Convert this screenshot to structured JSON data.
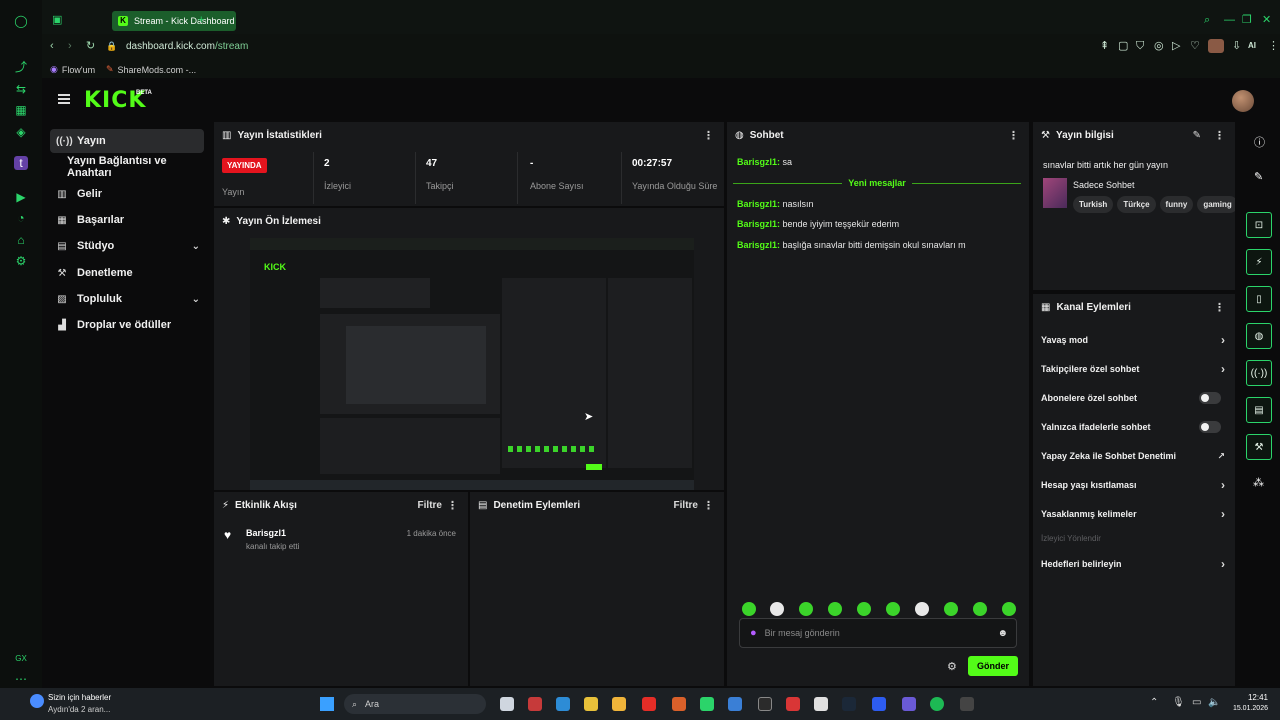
{
  "browser": {
    "tab_title": "Stream - Kick Dashboard",
    "url_host": "dashboard.kick.com",
    "url_path": "/stream",
    "bookmarks": [
      "Flow'um",
      "ShareMods.com -..."
    ],
    "ai_label": "AI"
  },
  "header": {
    "logo": "KICK",
    "beta": "BETA"
  },
  "sidebar": {
    "items": [
      {
        "label": "Yayın",
        "icon": "broadcast-icon"
      },
      {
        "label": "Yayın Bağlantısı ve Anahtarı"
      },
      {
        "label": "Gelir",
        "icon": "chart-icon"
      },
      {
        "label": "Başarılar",
        "icon": "trophy-icon"
      },
      {
        "label": "Stüdyo",
        "icon": "studio-icon"
      },
      {
        "label": "Denetleme",
        "icon": "wrench-icon"
      },
      {
        "label": "Topluluk",
        "icon": "community-icon"
      },
      {
        "label": "Droplar ve ödüller",
        "icon": "drops-icon"
      }
    ]
  },
  "stats": {
    "title": "Yayın İstatistikleri",
    "status_badge": "YAYINDA",
    "status_label": "Yayın",
    "viewers_value": "2",
    "viewers_label": "İzleyici",
    "followers_value": "47",
    "followers_label": "Takipçi",
    "subs_value": "-",
    "subs_label": "Abone Sayısı",
    "duration_value": "00:27:57",
    "duration_label": "Yayında Olduğu Süre"
  },
  "preview": {
    "title": "Yayın Ön İzlemesi"
  },
  "activity": {
    "title": "Etkinlik Akışı",
    "filter": "Filtre",
    "items": [
      {
        "user": "Barisgzl1",
        "action": "kanalı takip etti",
        "time": "1 dakika önce"
      }
    ]
  },
  "moderation_actions": {
    "title": "Denetim Eylemleri",
    "filter": "Filtre"
  },
  "chat": {
    "title": "Sohbet",
    "messages_before": [
      {
        "user": "Barisgzl1:",
        "text": "sa"
      }
    ],
    "new_messages_label": "Yeni mesajlar",
    "messages_after": [
      {
        "user": "Barisgzl1:",
        "text": "nasılsın"
      },
      {
        "user": "Barisgzl1:",
        "text": "bende iyiyim teşşekür ederim"
      },
      {
        "user": "Barisgzl1:",
        "text": "başlığa sınavlar bitti demişsin okul sınavları m"
      }
    ],
    "input_placeholder": "Bir mesaj gönderin",
    "send_label": "Gönder"
  },
  "stream_info": {
    "title": "Yayın bilgisi",
    "stream_title": "sınavlar bitti artık her gün yayın",
    "category": "Sadece Sohbet",
    "tags": [
      "Turkish",
      "Türkçe",
      "funny",
      "gaming"
    ]
  },
  "channel_actions": {
    "title": "Kanal Eylemleri",
    "items": [
      {
        "label": "Yavaş mod",
        "control": "chevron"
      },
      {
        "label": "Takipçilere özel sohbet",
        "control": "chevron"
      },
      {
        "label": "Abonelere özel sohbet",
        "control": "toggle"
      },
      {
        "label": "Yalnızca ifadelerle sohbet",
        "control": "toggle"
      },
      {
        "label": "Yapay Zeka ile Sohbet Denetimi",
        "control": "external"
      },
      {
        "label": "Hesap yaşı kısıtlaması",
        "control": "chevron"
      },
      {
        "label": "Yasaklanmış kelimeler",
        "control": "chevron"
      }
    ],
    "section_label": "İzleyici Yönlendir",
    "goal_label": "Hedefleri belirleyin"
  },
  "taskbar": {
    "news_title": "Sizin için haberler",
    "news_sub": "Aydın'da 2 aran...",
    "search_placeholder": "Ara",
    "time": "12:41",
    "date": "15.01.2026"
  },
  "colors": {
    "accent": "#53fc18",
    "live": "#e4141e",
    "panel": "#18191b"
  }
}
